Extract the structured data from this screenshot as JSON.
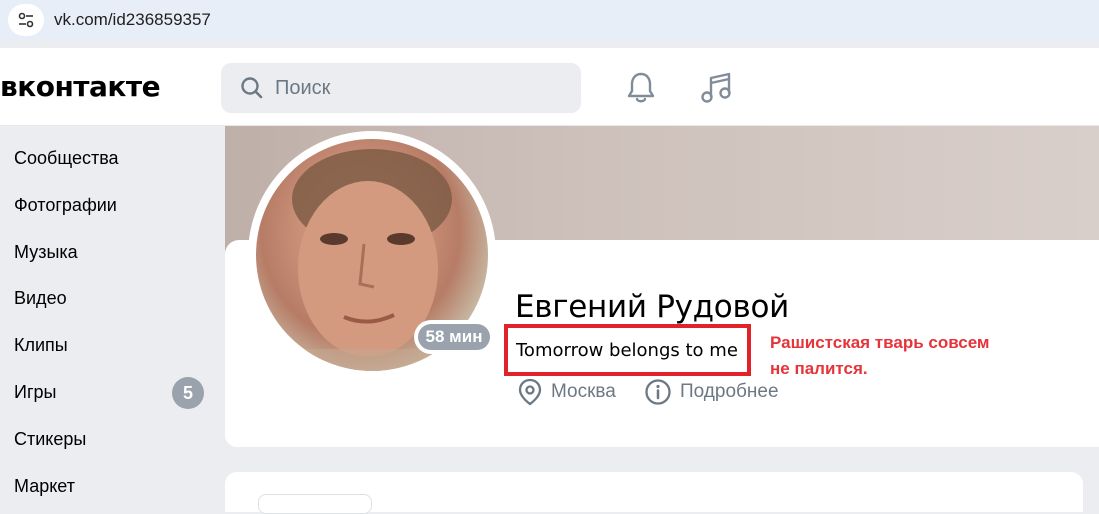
{
  "browser": {
    "url": "vk.com/id236859357",
    "site_info_icon": "tune-icon"
  },
  "header": {
    "logo_text": "вконтакте",
    "search_placeholder": "Поиск",
    "icons": [
      "bell-icon",
      "music-note-icon"
    ]
  },
  "sidebar": {
    "items": [
      {
        "label": "Сообщества"
      },
      {
        "label": "Фотографии"
      },
      {
        "label": "Музыка"
      },
      {
        "label": "Видео"
      },
      {
        "label": "Клипы"
      },
      {
        "label": "Игры",
        "badge": "5"
      },
      {
        "label": "Стикеры"
      },
      {
        "label": "Маркет"
      }
    ]
  },
  "profile": {
    "name": "Евгений Рудовой",
    "status": "Tomorrow belongs to me",
    "last_seen": "58 мин",
    "city": "Москва",
    "details_link": "Подробнее"
  },
  "annotation": {
    "line1": "Рашистская тварь совсем",
    "line2": "не палится.",
    "color": "#e5343a"
  },
  "colors": {
    "page_bg": "#ebedf0",
    "secondary_text": "#6d7885",
    "badge": "#99a2ad",
    "highlight_box": "#e2222a"
  }
}
